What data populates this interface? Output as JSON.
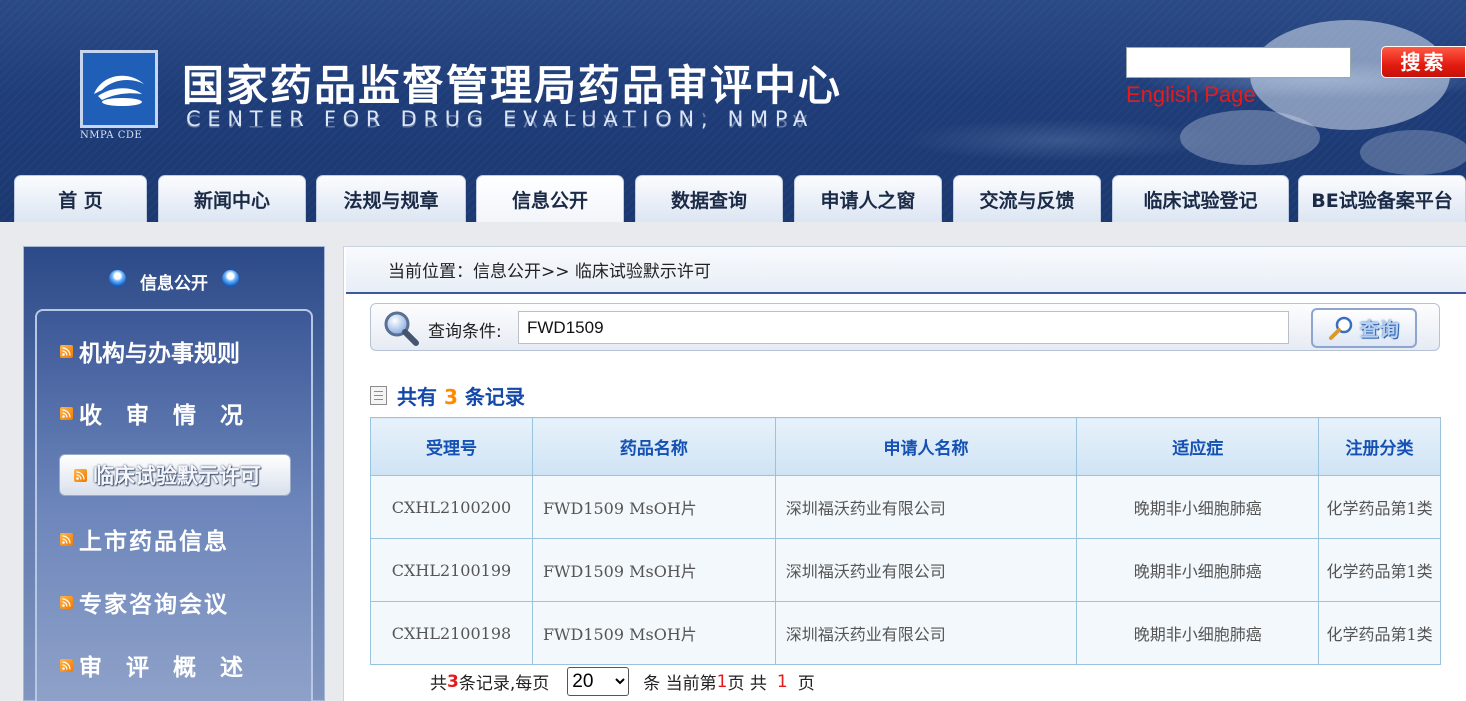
{
  "header": {
    "logo_caption": "NMPA CDE",
    "title_cn": "国家药品监督管理局药品审评中心",
    "title_en": "CENTER FOR DRUG EVALUATION, NMPA",
    "search_button": "搜索",
    "search_value": "",
    "english_link": "English Page"
  },
  "nav": {
    "tabs": [
      {
        "label": "首  页"
      },
      {
        "label": "新闻中心"
      },
      {
        "label": "法规与规章"
      },
      {
        "label": "信息公开"
      },
      {
        "label": "数据查询"
      },
      {
        "label": "申请人之窗"
      },
      {
        "label": "交流与反馈"
      },
      {
        "label": "临床试验登记"
      },
      {
        "label": "BE试验备案平台"
      }
    ],
    "active_tab": "信息公开"
  },
  "sidebar": {
    "title": "信息公开",
    "items": [
      {
        "label": "机构与办事规则"
      },
      {
        "label": "收 审 情 况"
      },
      {
        "label": "临床试验默示许可"
      },
      {
        "label": "上市药品信息"
      },
      {
        "label": "专家咨询会议"
      },
      {
        "label": "审 评 概 述"
      }
    ]
  },
  "breadcrumb": "当前位置：信息公开>> 临床试验默示许可",
  "query": {
    "label": "查询条件:",
    "value": "FWD1509",
    "button": "查询"
  },
  "summary": {
    "prefix": "共有",
    "count": "3",
    "suffix": "条记录"
  },
  "table": {
    "columns": [
      "受理号",
      "药品名称",
      "申请人名称",
      "适应症",
      "注册分类"
    ],
    "rows": [
      [
        "CXHL2100200",
        "FWD1509 MsOH片",
        "深圳福沃药业有限公司",
        "晚期非小细胞肺癌",
        "化学药品第1类"
      ],
      [
        "CXHL2100199",
        "FWD1509 MsOH片",
        "深圳福沃药业有限公司",
        "晚期非小细胞肺癌",
        "化学药品第1类"
      ],
      [
        "CXHL2100198",
        "FWD1509 MsOH片",
        "深圳福沃药业有限公司",
        "晚期非小细胞肺癌",
        "化学药品第1类"
      ]
    ]
  },
  "pager": {
    "t1": "共",
    "total": "3",
    "t2": "条记录,每页",
    "page_size": "20",
    "t3": "条 当前第",
    "current_page": "1",
    "t4": "页 共",
    "total_pages": "1",
    "t5": "页"
  },
  "colors": {
    "header_bg": "#1e3c78",
    "accent_red": "#e41b1b",
    "link_blue": "#1347a8",
    "count_orange": "#ff8a00"
  }
}
